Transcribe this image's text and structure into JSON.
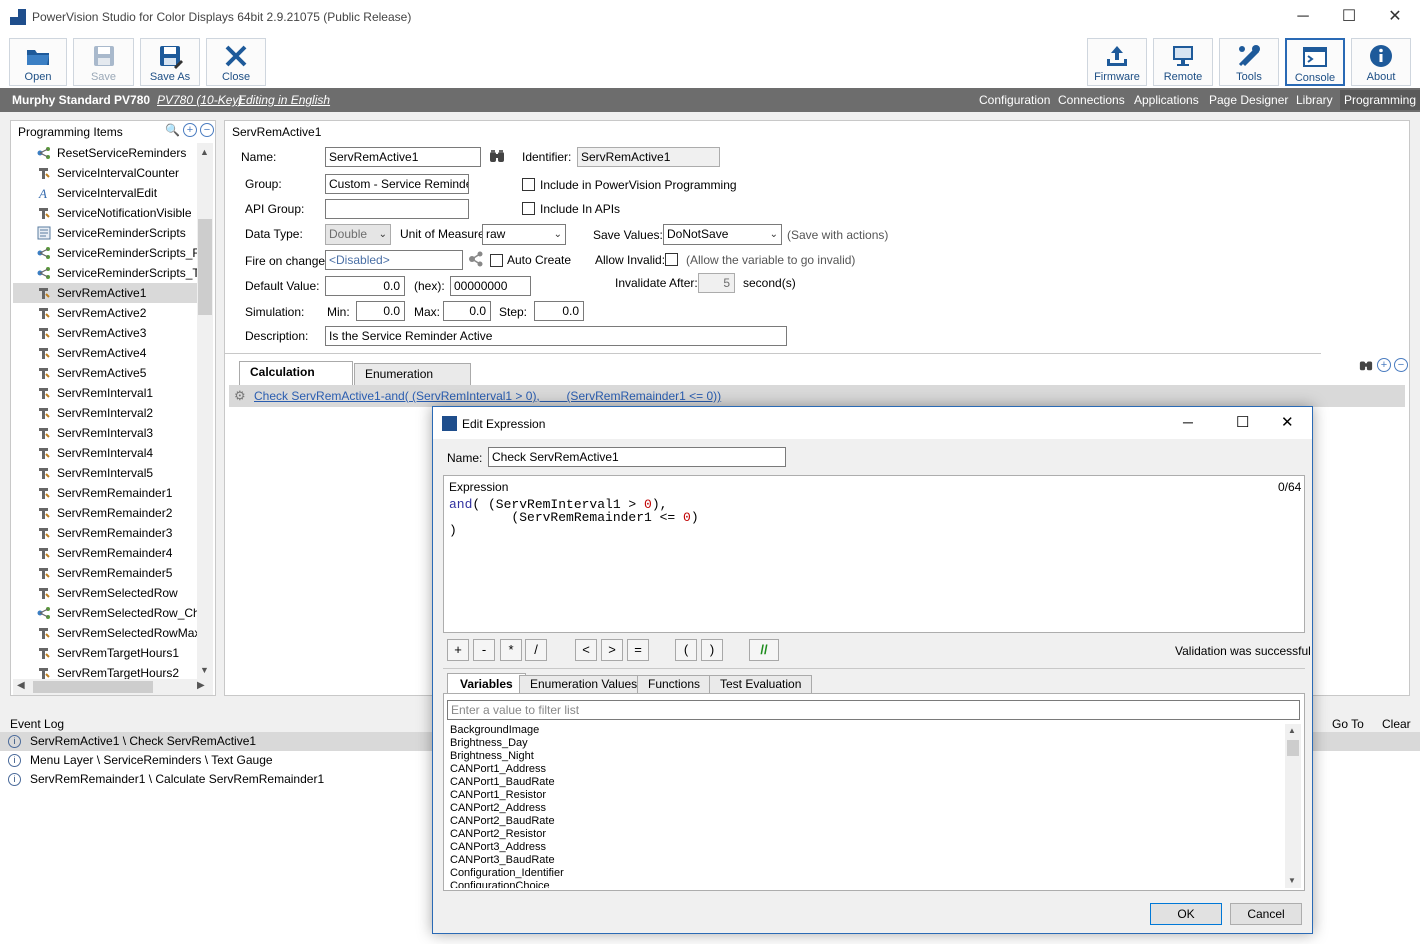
{
  "window": {
    "title": "PowerVision Studio for Color Displays 64bit 2.9.21075 (Public Release)",
    "controls": {
      "minimize": "─",
      "maximize": "☐",
      "close": "✕"
    }
  },
  "toolbar": {
    "open": "Open",
    "save": "Save",
    "save_as": "Save As",
    "close": "Close",
    "firmware": "Firmware",
    "remote": "Remote",
    "tools": "Tools",
    "console": "Console",
    "about": "About"
  },
  "menubar": {
    "project": "Murphy Standard PV780",
    "model": "PV780 (10-Key)",
    "language": "Editing in English",
    "nav": [
      "Configuration",
      "Connections",
      "Applications",
      "Page Designer",
      "Library",
      "Programming"
    ]
  },
  "left_panel": {
    "title": "Programming Items",
    "items": [
      {
        "label": "ResetServiceReminders",
        "icon": "script-icon"
      },
      {
        "label": "ServiceIntervalCounter",
        "icon": "variable-icon"
      },
      {
        "label": "ServiceIntervalEdit",
        "icon": "text-icon"
      },
      {
        "label": "ServiceNotificationVisible",
        "icon": "variable-icon"
      },
      {
        "label": "ServiceReminderScripts",
        "icon": "script-list-icon"
      },
      {
        "label": "ServiceReminderScripts_From",
        "icon": "script-icon"
      },
      {
        "label": "ServiceReminderScripts_ToK",
        "icon": "script-icon"
      },
      {
        "label": "ServRemActive1",
        "icon": "variable-icon"
      },
      {
        "label": "ServRemActive2",
        "icon": "variable-icon"
      },
      {
        "label": "ServRemActive3",
        "icon": "variable-icon"
      },
      {
        "label": "ServRemActive4",
        "icon": "variable-icon"
      },
      {
        "label": "ServRemActive5",
        "icon": "variable-icon"
      },
      {
        "label": "ServRemInterval1",
        "icon": "variable-icon"
      },
      {
        "label": "ServRemInterval2",
        "icon": "variable-icon"
      },
      {
        "label": "ServRemInterval3",
        "icon": "variable-icon"
      },
      {
        "label": "ServRemInterval4",
        "icon": "variable-icon"
      },
      {
        "label": "ServRemInterval5",
        "icon": "variable-icon"
      },
      {
        "label": "ServRemRemainder1",
        "icon": "variable-icon"
      },
      {
        "label": "ServRemRemainder2",
        "icon": "variable-icon"
      },
      {
        "label": "ServRemRemainder3",
        "icon": "variable-icon"
      },
      {
        "label": "ServRemRemainder4",
        "icon": "variable-icon"
      },
      {
        "label": "ServRemRemainder5",
        "icon": "variable-icon"
      },
      {
        "label": "ServRemSelectedRow",
        "icon": "variable-icon"
      },
      {
        "label": "ServRemSelectedRow_Chan",
        "icon": "script-icon"
      },
      {
        "label": "ServRemSelectedRowMax",
        "icon": "variable-icon"
      },
      {
        "label": "ServRemTargetHours1",
        "icon": "variable-icon"
      },
      {
        "label": "ServRemTargetHours2",
        "icon": "variable-icon"
      }
    ]
  },
  "props": {
    "heading": "ServRemActive1",
    "name_label": "Name:",
    "name_value": "ServRemActive1",
    "identifier_label": "Identifier:",
    "identifier_value": "ServRemActive1",
    "group_label": "Group:",
    "group_value": "Custom - Service Reminders",
    "include_pv_label": "Include in PowerVision Programming",
    "api_group_label": "API Group:",
    "api_group_value": "",
    "include_api_label": "Include In APIs",
    "data_type_label": "Data Type:",
    "data_type_value": "Double",
    "uom_label": "Unit of Measure:",
    "uom_value": "raw",
    "save_values_label": "Save Values:",
    "save_values_value": "DoNotSave",
    "save_values_note": "(Save with actions)",
    "fire_label": "Fire on change:",
    "fire_value": "<Disabled>",
    "auto_create_label": "Auto Create",
    "allow_invalid_label": "Allow Invalid:",
    "allow_invalid_note": "(Allow the variable to go invalid)",
    "default_label": "Default Value:",
    "default_value": "0.0",
    "hex_label": "(hex):",
    "hex_value": "00000000",
    "invalidate_label": "Invalidate After:",
    "invalidate_value": "5",
    "invalidate_unit": "second(s)",
    "sim_label": "Simulation:",
    "min_label": "Min:",
    "min_value": "0.0",
    "max_label": "Max:",
    "max_value": "0.0",
    "step_label": "Step:",
    "step_value": "0.0",
    "desc_label": "Description:",
    "desc_value": "Is the Service Reminder Active"
  },
  "calc": {
    "tabs": [
      "Calculation Events",
      "Enumeration Values"
    ],
    "event_link": "Check ServRemActive1-and( (ServRemInterval1 > 0),        (ServRemRemainder1 <= 0))"
  },
  "event_log": {
    "title": "Event Log",
    "goto": "Go To",
    "clear": "Clear",
    "rows": [
      "ServRemActive1 \\ Check ServRemActive1",
      "Menu Layer \\ ServiceReminders \\ Text Gauge",
      "ServRemRemainder1 \\ Calculate ServRemRemainder1"
    ]
  },
  "dialog": {
    "title": "Edit Expression",
    "name_label": "Name:",
    "name_value": "Check ServRemActive1",
    "expression_label": "Expression",
    "counter": "0/64",
    "code": {
      "l1a": "and",
      "l1b": "( (ServRemInterval1 > ",
      "l1c": "0",
      "l1d": "),",
      "l2a": "        (ServRemRemainder1 <= ",
      "l2b": "0",
      "l2c": ")",
      "l3": ")"
    },
    "ops": [
      "+",
      "-",
      "*",
      "/",
      "<",
      ">",
      "=",
      "(",
      ")",
      "//"
    ],
    "validation": "Validation was successful",
    "tabs": [
      "Variables",
      "Enumeration Values",
      "Functions",
      "Test Evaluation"
    ],
    "filter_placeholder": "Enter a value to filter list",
    "variables": [
      "BackgroundImage",
      "Brightness_Day",
      "Brightness_Night",
      "CANPort1_Address",
      "CANPort1_BaudRate",
      "CANPort1_Resistor",
      "CANPort2_Address",
      "CANPort2_BaudRate",
      "CANPort2_Resistor",
      "CANPort3_Address",
      "CANPort3_BaudRate",
      "Configuration_Identifier",
      "ConfigurationChoice"
    ],
    "ok": "OK",
    "cancel": "Cancel"
  }
}
